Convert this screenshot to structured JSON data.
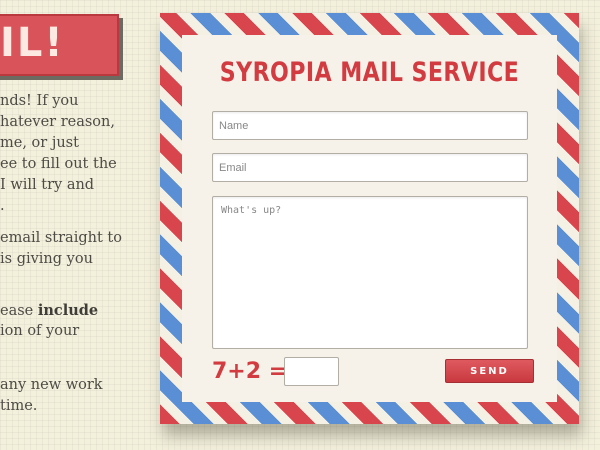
{
  "left_panel": {
    "banner_text": "IL!",
    "paragraphs": [
      [
        "nds! If you",
        "hatever reason,",
        "me, or just",
        "ee to fill out the",
        "I will try and",
        "."
      ],
      [
        "email straight to",
        "is giving you"
      ],
      [
        {
          "before": "ease ",
          "bold": "include"
        },
        "ion of your"
      ],
      [
        "any new work",
        "time."
      ]
    ]
  },
  "form": {
    "title": "SYROPIA MAIL SERVICE",
    "name_placeholder": "Name",
    "email_placeholder": "Email",
    "message_placeholder": "What's up?",
    "captcha_question": "7+2 =",
    "captcha_value": "",
    "send_label": "SEND"
  },
  "colors": {
    "accent_red": "#d23b40",
    "stripe_blue": "#5a8fd6",
    "paper": "#f6f2ea"
  }
}
